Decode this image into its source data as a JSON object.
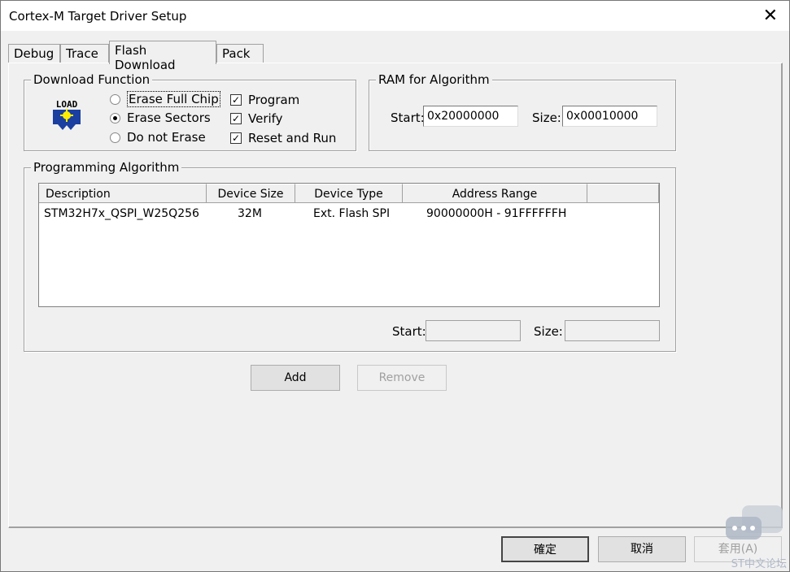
{
  "window": {
    "title": "Cortex-M Target Driver Setup"
  },
  "tabs": [
    {
      "label": "Debug"
    },
    {
      "label": "Trace"
    },
    {
      "label": "Flash Download"
    },
    {
      "label": "Pack"
    }
  ],
  "download_function": {
    "label": "Download Function",
    "icon_text": "LOAD",
    "radios": [
      {
        "label": "Erase Full Chip",
        "checked": false
      },
      {
        "label": "Erase Sectors",
        "checked": true
      },
      {
        "label": "Do not Erase",
        "checked": false
      }
    ],
    "checks": [
      {
        "label": "Program",
        "checked": true
      },
      {
        "label": "Verify",
        "checked": true
      },
      {
        "label": "Reset and Run",
        "checked": true
      }
    ]
  },
  "ram": {
    "label": "RAM for Algorithm",
    "start_label": "Start:",
    "start_value": "0x20000000",
    "size_label": "Size:",
    "size_value": "0x00010000"
  },
  "algorithm": {
    "label": "Programming Algorithm",
    "columns": [
      "Description",
      "Device Size",
      "Device Type",
      "Address Range"
    ],
    "rows": [
      {
        "description": "STM32H7x_QSPI_W25Q256",
        "size": "32M",
        "type": "Ext. Flash SPI",
        "range": "90000000H - 91FFFFFFH"
      }
    ],
    "start_label": "Start:",
    "size_label": "Size:",
    "start_value": "",
    "size_value": ""
  },
  "buttons": {
    "add": "Add",
    "remove": "Remove",
    "ok": "確定",
    "cancel": "取消",
    "apply": "套用(A)"
  },
  "watermark": "ST中文论坛"
}
